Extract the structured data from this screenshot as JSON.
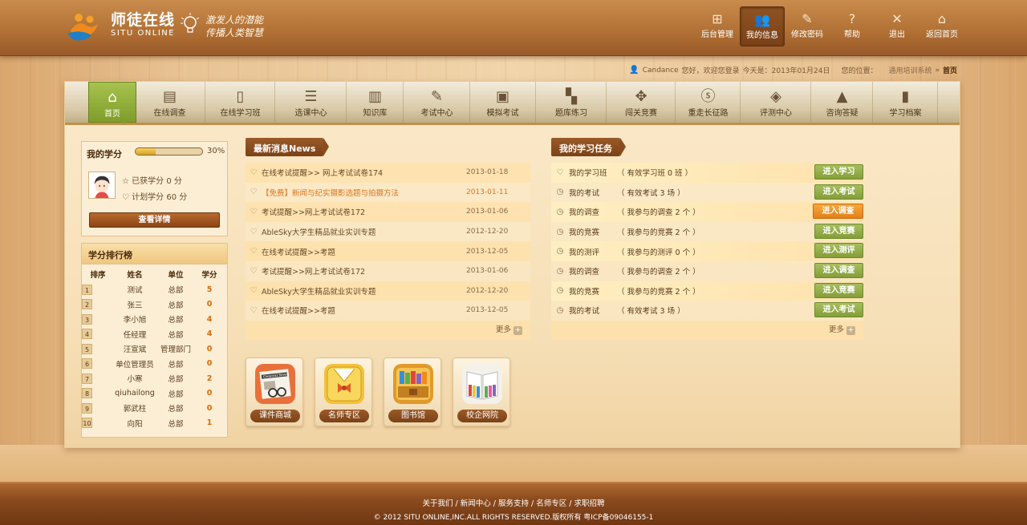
{
  "brand": {
    "name_cn": "师徒在线",
    "name_en": "SITU ONLINE",
    "slogan_line1": "激发人的潜能",
    "slogan_line2": "传播人类智慧"
  },
  "topnav": [
    {
      "label": "后台管理",
      "icon": "grid-icon"
    },
    {
      "label": "我的信息",
      "icon": "users-icon",
      "active": true
    },
    {
      "label": "修改密码",
      "icon": "edit-icon"
    },
    {
      "label": "帮助",
      "icon": "help-icon"
    },
    {
      "label": "退出",
      "icon": "close-icon"
    },
    {
      "label": "返回首页",
      "icon": "home-icon"
    }
  ],
  "userbar": {
    "username": "Candance",
    "greeting": "您好，欢迎您登录",
    "today": "今天是：2013年01月24日",
    "location_label": "您的位置：",
    "location_path": "通用培训系统",
    "location_current": "首页"
  },
  "mainnav": [
    {
      "label": "首页",
      "icon": "home-icon",
      "active": true
    },
    {
      "label": "在线调查",
      "icon": "notebook-icon"
    },
    {
      "label": "在线学习班",
      "icon": "book-icon"
    },
    {
      "label": "选课中心",
      "icon": "books-stack-icon"
    },
    {
      "label": "知识库",
      "icon": "library-icon"
    },
    {
      "label": "考试中心",
      "icon": "pencil-icon"
    },
    {
      "label": "模拟考试",
      "icon": "picture-icon"
    },
    {
      "label": "题库练习",
      "icon": "checkerboard-icon"
    },
    {
      "label": "闯关竞赛",
      "icon": "puzzle-icon"
    },
    {
      "label": "重走长征路",
      "icon": "stumble-icon"
    },
    {
      "label": "评测中心",
      "icon": "target-icon"
    },
    {
      "label": "咨询答疑",
      "icon": "warning-icon"
    },
    {
      "label": "学习档案",
      "icon": "document-icon"
    }
  ],
  "credits": {
    "title": "我的学分",
    "progress_percent": 30,
    "percent_label": "30%",
    "earned": "已获学分 0 分",
    "planned": "计划学分 60 分",
    "detail_button": "查看详情"
  },
  "ranking": {
    "title": "学分排行榜",
    "headers": [
      "排序",
      "姓名",
      "单位",
      "学分"
    ],
    "rows": [
      {
        "rank": "1",
        "name": "测试",
        "unit": "总部",
        "score": "5"
      },
      {
        "rank": "2",
        "name": "张三",
        "unit": "总部",
        "score": "0"
      },
      {
        "rank": "3",
        "name": "李小旭",
        "unit": "总部",
        "score": "4"
      },
      {
        "rank": "4",
        "name": "任经理",
        "unit": "总部",
        "score": "4"
      },
      {
        "rank": "5",
        "name": "汪宣斌",
        "unit": "管理部门",
        "score": "0"
      },
      {
        "rank": "6",
        "name": "单位管理员",
        "unit": "总部",
        "score": "0"
      },
      {
        "rank": "7",
        "name": "小寒",
        "unit": "总部",
        "score": "2"
      },
      {
        "rank": "8",
        "name": "qiuhailong",
        "unit": "总部",
        "score": "0"
      },
      {
        "rank": "9",
        "name": "郭武柱",
        "unit": "总部",
        "score": "0"
      },
      {
        "rank": "10",
        "name": "向阳",
        "unit": "总部",
        "score": "1"
      }
    ]
  },
  "news": {
    "title": "最新消息News",
    "items": [
      {
        "text": "在线考试提醒>> 网上考试试卷174",
        "date": "2013-01-18"
      },
      {
        "text": "【免费】新闻与纪实摄影选题与拍摄方法",
        "date": "2013-01-11",
        "highlight": true
      },
      {
        "text": "考试提醒>>网上考试试卷172",
        "date": "2013-01-06"
      },
      {
        "text": "AbleSky大学生精品就业实训专题",
        "date": "2012-12-20"
      },
      {
        "text": "在线考试提醒>>考题",
        "date": "2013-12-05"
      },
      {
        "text": "考试提醒>>网上考试试卷172",
        "date": "2013-01-06"
      },
      {
        "text": "AbleSky大学生精品就业实训专题",
        "date": "2012-12-20"
      },
      {
        "text": "在线考试提醒>>考题",
        "date": "2013-12-05"
      }
    ],
    "more_label": "更多"
  },
  "tasks": {
    "title": "我的学习任务",
    "items": [
      {
        "name": "我的学习班",
        "desc": "（ 有效学习班 0 班 ）",
        "button": "进入学习"
      },
      {
        "name": "我的考试",
        "desc": "（ 有效考试 3 场 ）",
        "button": "进入考试"
      },
      {
        "name": "我的调查",
        "desc": "（ 我参与的调查 2 个 ）",
        "button": "进入调查",
        "active": true
      },
      {
        "name": "我的竞赛",
        "desc": "（ 我参与的竞赛 2 个 ）",
        "button": "进入竞赛"
      },
      {
        "name": "我的测评",
        "desc": "（ 我参与的测评 0 个 ）",
        "button": "进入测评"
      },
      {
        "name": "我的调查",
        "desc": "（ 我参与的调查 2 个 ）",
        "button": "进入调查"
      },
      {
        "name": "我的竞赛",
        "desc": "（ 我参与的竞赛 2 个 ）",
        "button": "进入竞赛"
      },
      {
        "name": "我的考试",
        "desc": "（ 有效考试 3 场 ）",
        "button": "进入考试"
      }
    ],
    "more_label": "更多"
  },
  "apps": [
    {
      "label": "课件商城",
      "icon": "newspaper-icon",
      "print": "General News"
    },
    {
      "label": "名师专区",
      "icon": "teacher-icon"
    },
    {
      "label": "图书馆",
      "icon": "bookcase-icon"
    },
    {
      "label": "校企网院",
      "icon": "open-book-icon"
    }
  ],
  "footer": {
    "links": "关于我们 / 新闻中心 / 服务支持 / 名师专区 / 求职招聘",
    "copyright": "© 2012 SITU ONLINE,INC.ALL RIGHTS RESERVED.版权所有 粤ICP备09046155-1"
  }
}
